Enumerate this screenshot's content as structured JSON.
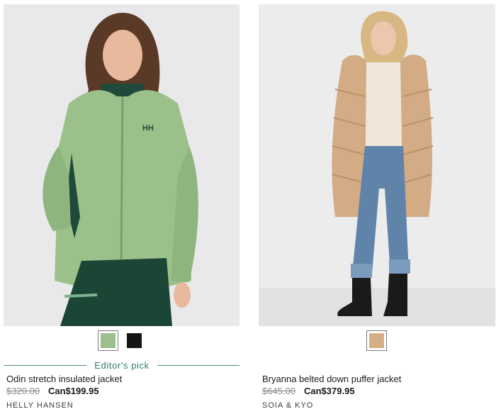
{
  "products": [
    {
      "name": "Odin stretch insulated jacket",
      "old_price": "$320.00",
      "sale_price": "Can$199.95",
      "brand": "HELLY HANSEN",
      "badge": "Editor's pick",
      "image_alt": "Woman wearing a green Helly Hansen insulated jacket",
      "swatches": [
        {
          "color": "#9dbf8e",
          "selected": true
        },
        {
          "color": "#151515",
          "selected": false
        }
      ]
    },
    {
      "name": "Bryanna belted down puffer jacket",
      "old_price": "$645.00",
      "sale_price": "Can$379.95",
      "brand": "SOIA & KYO",
      "image_alt": "Woman wearing a long camel belted down puffer coat",
      "swatches": [
        {
          "color": "#d6ae86",
          "selected": true
        }
      ]
    }
  ],
  "colors": {
    "accent": "#2f7a66",
    "old_price": "#8a8a8a",
    "text": "#1b1b1b"
  }
}
